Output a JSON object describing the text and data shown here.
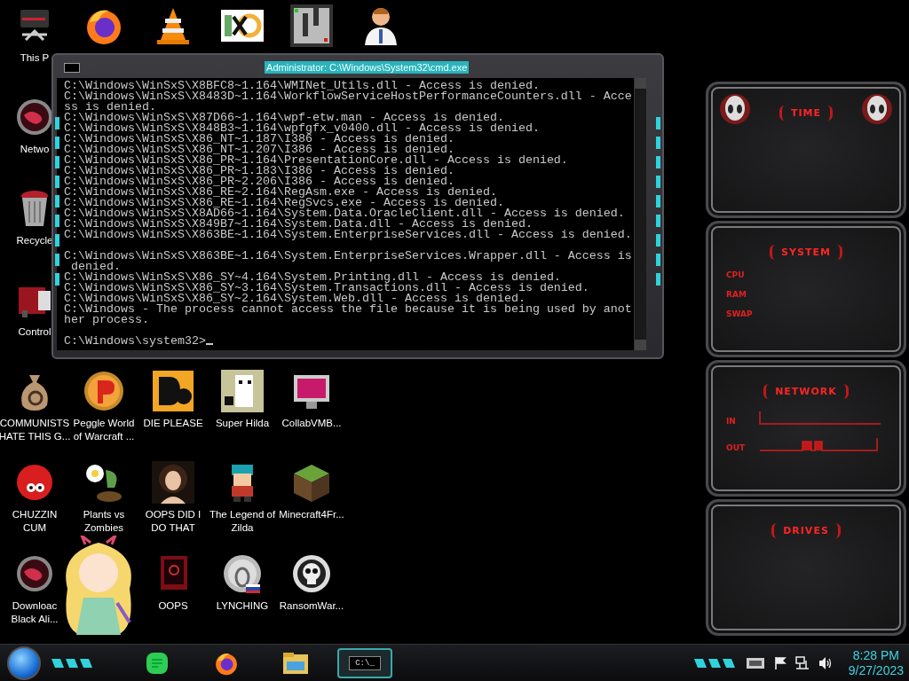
{
  "desktop_icons": [
    [
      {
        "kind": "monitor",
        "label": [
          "This P"
        ]
      },
      {
        "kind": "firefox"
      },
      {
        "kind": "cone"
      },
      {
        "kind": "hxd"
      },
      {
        "kind": "maze"
      },
      {
        "kind": "doctor"
      }
    ],
    [
      {
        "kind": "orb",
        "label": [
          "Netwo"
        ]
      }
    ],
    [
      {
        "kind": "bin",
        "label": [
          "Recycle"
        ]
      }
    ],
    [
      {
        "kind": "device",
        "label": [
          "Control"
        ]
      }
    ],
    [
      {
        "kind": "moneybag",
        "label": [
          "COMMUNISTS",
          "HATE THIS G..."
        ]
      },
      {
        "kind": "peggle",
        "label": [
          "Peggle World",
          "of Warcraft ..."
        ]
      },
      {
        "kind": "de",
        "label": [
          "DIE PLEASE"
        ]
      },
      {
        "kind": "pixel",
        "label": [
          "Super Hilda"
        ]
      },
      {
        "kind": "screen",
        "label": [
          "CollabVMB..."
        ]
      }
    ],
    [
      {
        "kind": "furball",
        "label": [
          "CHUZZIN",
          "CUM"
        ]
      },
      {
        "kind": "plant",
        "label": [
          "Plants vs",
          "Zombies"
        ]
      },
      {
        "kind": "portrait",
        "label": [
          "OOPS DID I",
          "DO THAT"
        ]
      },
      {
        "kind": "hero",
        "label": [
          "The Legend of",
          "Zilda"
        ]
      },
      {
        "kind": "block",
        "label": [
          "Minecraft4Fr..."
        ]
      }
    ],
    [
      {
        "kind": "orb",
        "label": [
          "Downloac",
          "Black Ali..."
        ]
      },
      {
        "kind": "blank"
      },
      {
        "kind": "frame",
        "label": [
          "OOPS"
        ]
      },
      {
        "kind": "seal",
        "label": [
          "LYNCHING"
        ]
      },
      {
        "kind": "skull",
        "label": [
          "RansomWar..."
        ]
      }
    ]
  ],
  "console": {
    "title": "Administrator: C:\\Windows\\System32\\cmd.exe",
    "output_blocks": [
      [
        "C:\\Windows\\WinSxS\\X8BFC8~1.164\\WMINet_Utils.dll - Access is denied.",
        "C:\\Windows\\WinSxS\\X8483D~1.164\\WorkflowServiceHostPerformanceCounters.dll - Acce",
        "ss is denied.",
        "C:\\Windows\\WinSxS\\X87D66~1.164\\wpf-etw.man - Access is denied.",
        "C:\\Windows\\WinSxS\\X848B3~1.164\\wpfgfx_v0400.dll - Access is denied.",
        "C:\\Windows\\WinSxS\\X86_NT~1.187\\I386 - Access is denied.",
        "C:\\Windows\\WinSxS\\X86_NT~1.207\\I386 - Access is denied.",
        "C:\\Windows\\WinSxS\\X86_PR~1.164\\PresentationCore.dll - Access is denied.",
        "C:\\Windows\\WinSxS\\X86_PR~1.183\\I386 - Access is denied.",
        "C:\\Windows\\WinSxS\\X86_PR~2.206\\I386 - Access is denied.",
        "C:\\Windows\\WinSxS\\X86_RE~2.164\\RegAsm.exe - Access is denied.",
        "C:\\Windows\\WinSxS\\X86_RE~1.164\\RegSvcs.exe - Access is denied.",
        "C:\\Windows\\WinSxS\\X8AD66~1.164\\System.Data.OracleClient.dll - Access is denied.",
        "C:\\Windows\\WinSxS\\X849B7~1.164\\System.Data.dll - Access is denied.",
        "C:\\Windows\\WinSxS\\X863BE~1.164\\System.EnterpriseServices.dll - Access is denied."
      ],
      [
        "C:\\Windows\\WinSxS\\X863BE~1.164\\System.EnterpriseServices.Wrapper.dll - Access is",
        " denied.",
        "C:\\Windows\\WinSxS\\X86_SY~4.164\\System.Printing.dll - Access is denied.",
        "C:\\Windows\\WinSxS\\X86_SY~3.164\\System.Transactions.dll - Access is denied.",
        "C:\\Windows\\WinSxS\\X86_SY~2.164\\System.Web.dll - Access is denied.",
        "C:\\Windows - The process cannot access the file because it is being used by anot",
        "her process."
      ]
    ],
    "prompt": "C:\\Windows\\system32>"
  },
  "gadgets": [
    {
      "kind": "time",
      "title": "TIME"
    },
    {
      "kind": "system",
      "title": "SYSTEM",
      "rows": [
        "CPU",
        "RAM",
        "SWAP"
      ]
    },
    {
      "kind": "network",
      "title": "NETWORK",
      "rows": [
        "IN",
        "OUT"
      ]
    },
    {
      "kind": "drives",
      "title": "DRIVES"
    }
  ],
  "taskbar": {
    "pinned": [
      {
        "kind": "chat",
        "selected": false
      },
      {
        "kind": "firefox",
        "selected": false
      },
      {
        "kind": "folder",
        "selected": false
      },
      {
        "kind": "console",
        "selected": true,
        "text": "C:\\_"
      }
    ],
    "clock": {
      "time": "8:28 PM",
      "date": "9/27/2023"
    }
  }
}
